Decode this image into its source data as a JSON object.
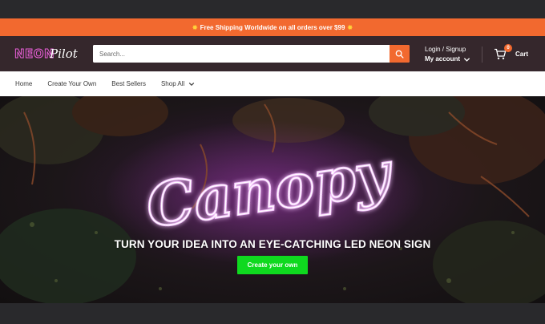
{
  "announcement": {
    "text": "Free Shipping Worldwide on all orders over $99",
    "star_color": "#ffd23a",
    "background": "#f2692f"
  },
  "header": {
    "logo_part1": "NEON",
    "logo_part2": "Pilot",
    "search_placeholder": "Search...",
    "search_icon": "search-icon",
    "login_label": "Login / Signup",
    "account_label": "My account",
    "cart_label": "Cart",
    "cart_count": "0",
    "accent_color": "#f2692f"
  },
  "nav": {
    "items": [
      {
        "label": "Home"
      },
      {
        "label": "Create Your Own"
      },
      {
        "label": "Best Sellers"
      },
      {
        "label": "Shop All"
      }
    ]
  },
  "hero": {
    "neon_word": "Canopy",
    "heading": "TURN YOUR IDEA INTO AN EYE-CATCHING LED NEON SIGN",
    "cta_label": "Create your own",
    "cta_color": "#0fd91f"
  }
}
